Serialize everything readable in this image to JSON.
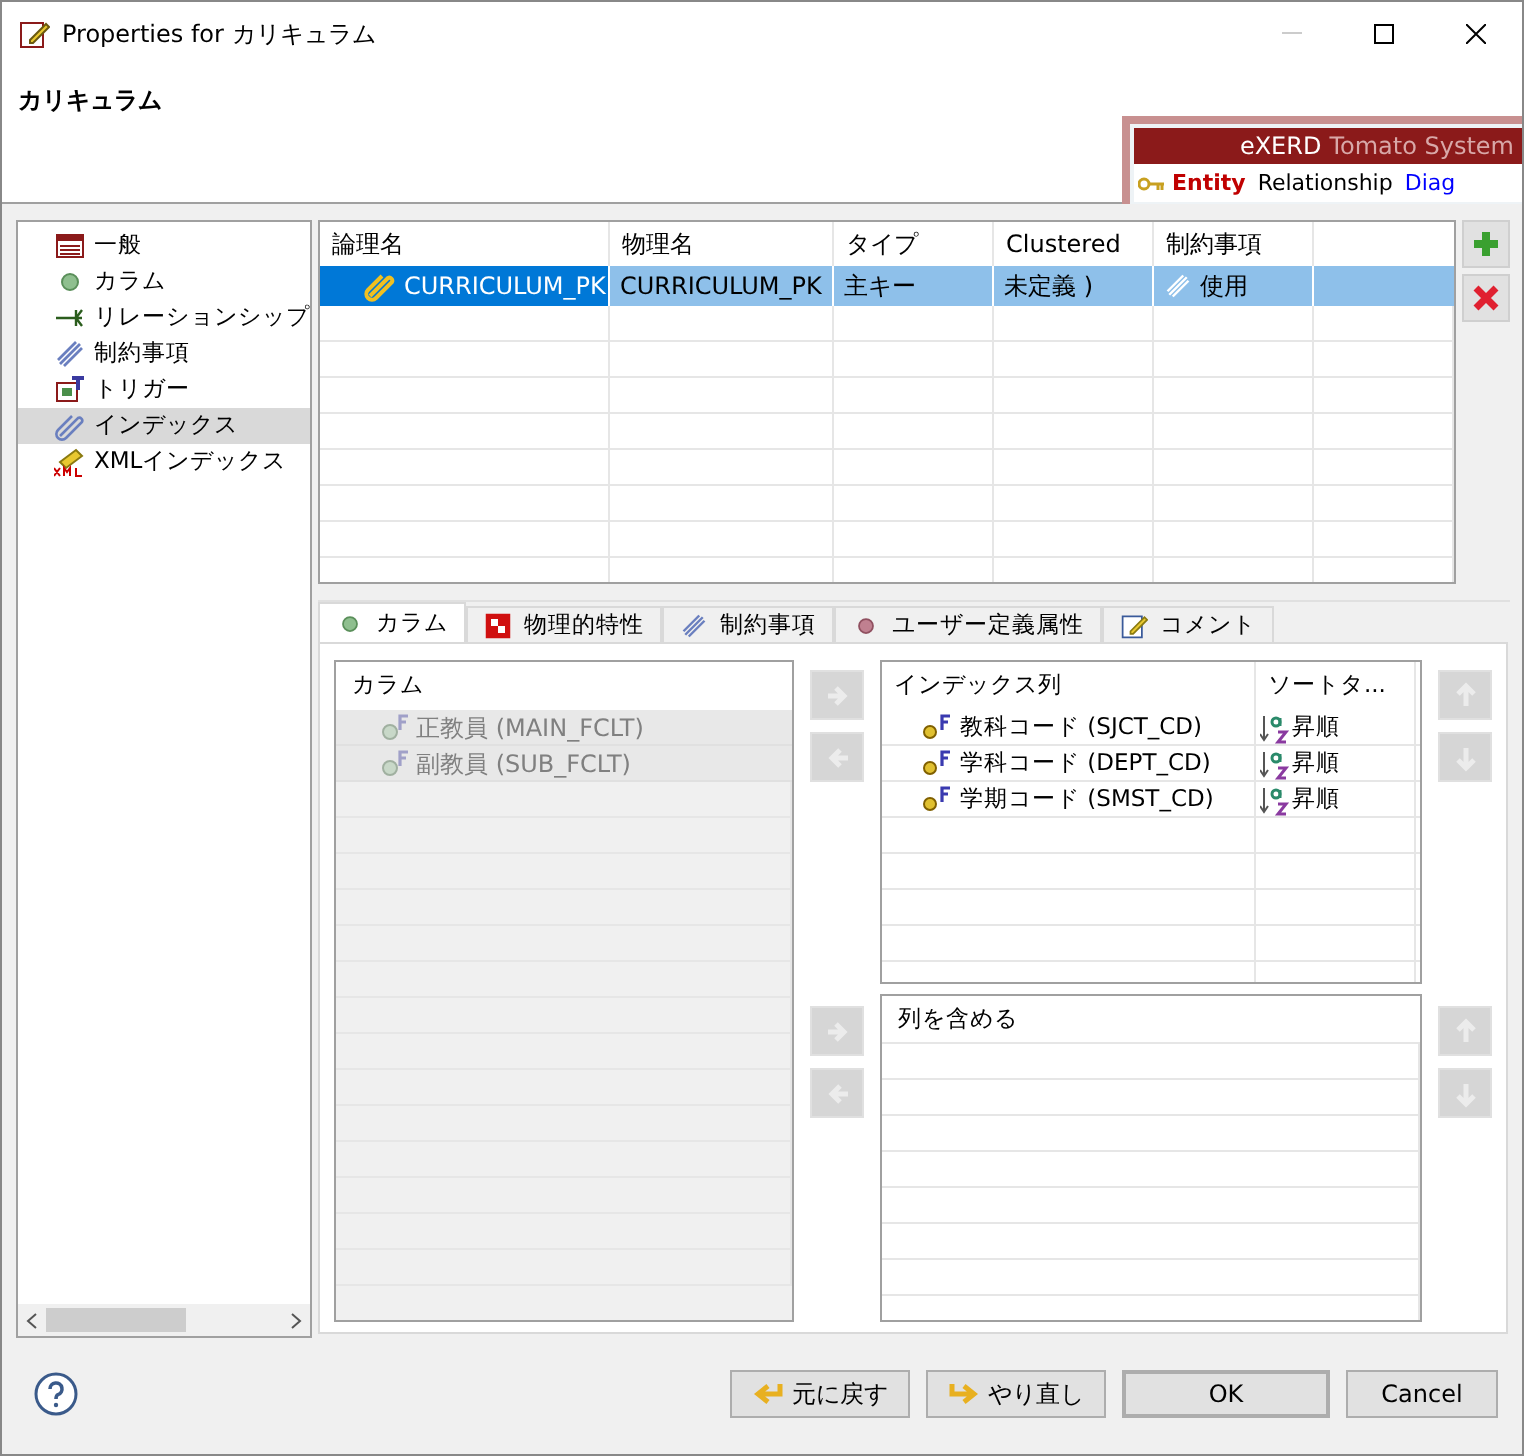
{
  "window": {
    "title": "Properties for カリキュラム"
  },
  "header": {
    "title": "カリキュラム"
  },
  "banner": {
    "brand": "eXERD",
    "product": "Tomato System",
    "tabs": [
      {
        "label": "Entity",
        "selected": true,
        "color": "#c00000"
      },
      {
        "label": "Relationship",
        "selected": false,
        "color": "#000000"
      },
      {
        "label": "Diag",
        "selected": false,
        "color": "#0000ff"
      }
    ]
  },
  "sidebar": {
    "items": [
      {
        "label": "一般",
        "kind": "general",
        "selected": false
      },
      {
        "label": "カラム",
        "kind": "column",
        "selected": false
      },
      {
        "label": "リレーションシップ",
        "kind": "relation",
        "selected": false
      },
      {
        "label": "制約事項",
        "kind": "constraint",
        "selected": false
      },
      {
        "label": "トリガー",
        "kind": "trigger",
        "selected": false
      },
      {
        "label": "インデックス",
        "kind": "index",
        "selected": true
      },
      {
        "label": "XMLインデックス",
        "kind": "xml",
        "selected": false
      }
    ]
  },
  "index_table": {
    "columns": [
      "論理名",
      "物理名",
      "タイプ",
      "Clustered",
      "制約事項"
    ],
    "rows": [
      {
        "selected": true,
        "cells": [
          "CURRICULUM_PK",
          "CURRICULUM_PK",
          "主キー",
          "未定義 )",
          "使用"
        ]
      }
    ]
  },
  "tabs": [
    {
      "label": "カラム",
      "kind": "column",
      "selected": true
    },
    {
      "label": "物理的特性",
      "kind": "physical",
      "selected": false
    },
    {
      "label": "制約事項",
      "kind": "constraint",
      "selected": false
    },
    {
      "label": "ユーザー定義属性",
      "kind": "user",
      "selected": false
    },
    {
      "label": "コメント",
      "kind": "comment",
      "selected": false
    }
  ],
  "columns_panel": {
    "header": "カラム",
    "disabled": true,
    "rows": [
      "正教員 (MAIN_FCLT)",
      "副教員 (SUB_FCLT)"
    ]
  },
  "index_columns": {
    "columns": [
      "インデックス列",
      "ソートタ..."
    ],
    "rows": [
      {
        "name": "教科コード (SJCT_CD)",
        "sort": "昇順"
      },
      {
        "name": "学科コード (DEPT_CD)",
        "sort": "昇順"
      },
      {
        "name": "学期コード (SMST_CD)",
        "sort": "昇順"
      }
    ]
  },
  "include_columns": {
    "header": "列を含める"
  },
  "buttons": [
    {
      "label": "元に戻す",
      "kind": "undo"
    },
    {
      "label": "やり直し",
      "kind": "redo"
    },
    {
      "label": "OK",
      "kind": "default"
    },
    {
      "label": "Cancel",
      "kind": "plain"
    }
  ]
}
